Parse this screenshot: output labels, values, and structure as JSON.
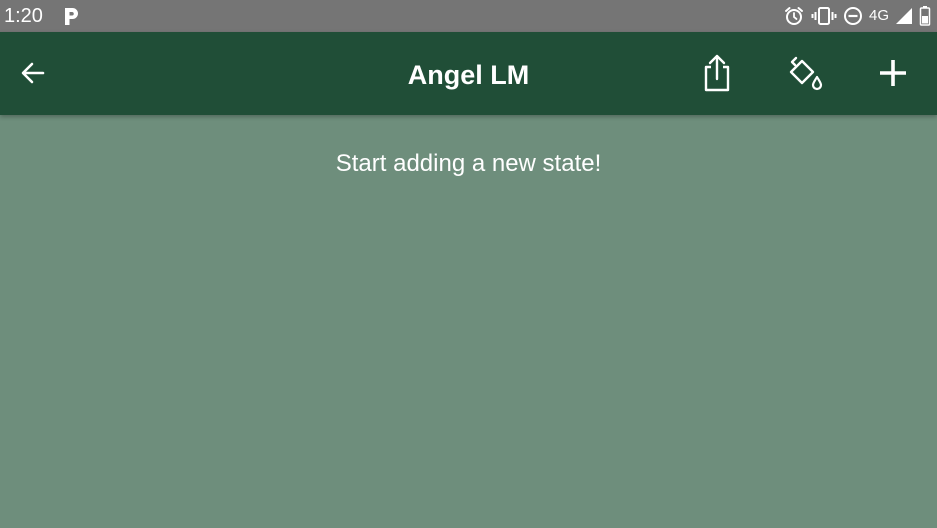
{
  "status_bar": {
    "time": "1:20",
    "network": "4G",
    "icons": [
      "parking-app-icon",
      "alarm-icon",
      "vibrate-icon",
      "do-not-disturb-icon",
      "signal-icon",
      "battery-icon"
    ]
  },
  "app_bar": {
    "title": "Angel LM",
    "background_color": "#204e37",
    "actions": [
      "back-arrow-icon",
      "share-icon",
      "paint-bucket-icon",
      "add-icon"
    ]
  },
  "content": {
    "empty_message": "Start adding a new state!",
    "background_color": "#6e8e7c"
  }
}
